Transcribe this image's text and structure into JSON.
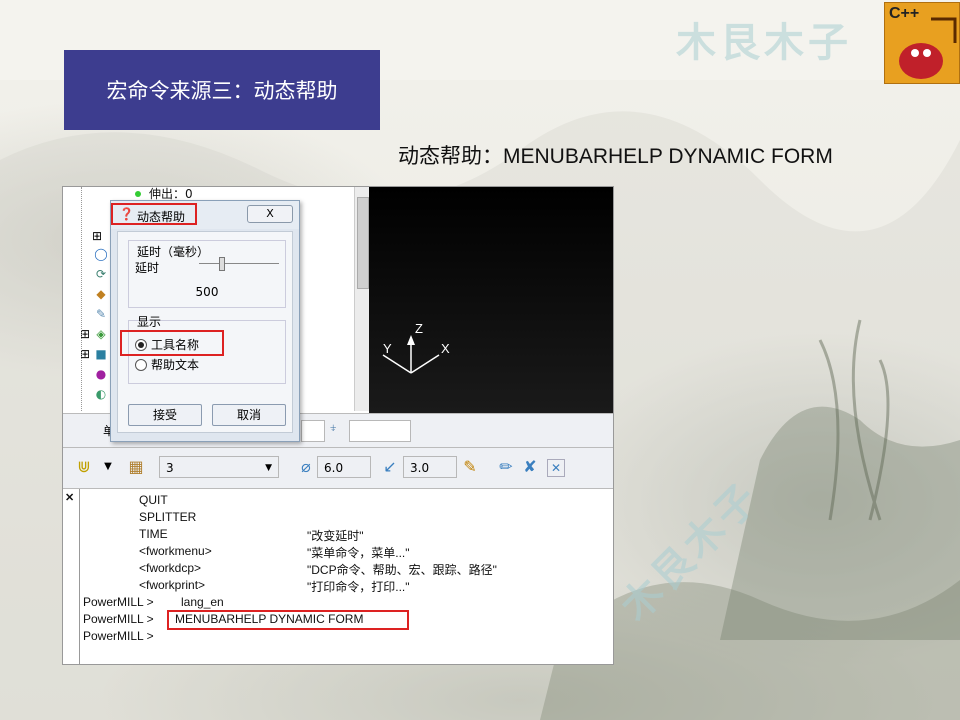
{
  "slide": {
    "title": "宏命令来源三：动态帮助",
    "subtitle": "动态帮助：MENUBARHELP DYNAMIC FORM",
    "watermark": "木艮木子",
    "logo_text": "C++"
  },
  "tree": {
    "top_item": "伸出：0",
    "icons": [
      "plus-node-icon",
      "circle-tool-icon",
      "toolpath-icon",
      "boundary-icon",
      "pattern-icon",
      "layer-icon",
      "model-icon",
      "stock-icon",
      "plane-icon"
    ]
  },
  "dialog": {
    "title": "动态帮助",
    "close_label": "X",
    "delay_group_title": "延时（毫秒）",
    "delay_label": "延时",
    "delay_value": "500",
    "display_group_title": "显示",
    "options": [
      {
        "label": "工具名称",
        "selected": true
      },
      {
        "label": "帮助文本",
        "selected": false
      }
    ],
    "ok_label": "接受",
    "cancel_label": "取消"
  },
  "viewport": {
    "axis_z": "Z",
    "axis_y": "Y",
    "axis_x": "X"
  },
  "status": {
    "prefix": "单"
  },
  "toolbar": {
    "tool_number": "3",
    "diameter": "6.0",
    "tip_radius": "3.0"
  },
  "console": {
    "lines": [
      {
        "a": "QUIT",
        "b": ""
      },
      {
        "a": "SPLITTER",
        "b": ""
      },
      {
        "a": "TIME",
        "b": "\"改变延时\""
      },
      {
        "a": "<fworkmenu>",
        "b": "\"菜单命令，菜单...\""
      },
      {
        "a": "<fworkdcp>",
        "b": "\"DCP命令、帮助、宏、跟踪、路径\""
      },
      {
        "a": "<fworkprint>",
        "b": "\"打印命令，打印...\""
      }
    ],
    "prompt": "PowerMILL >",
    "cmd1": "lang_en",
    "cmd2": "MENUBARHELP DYNAMIC FORM"
  }
}
